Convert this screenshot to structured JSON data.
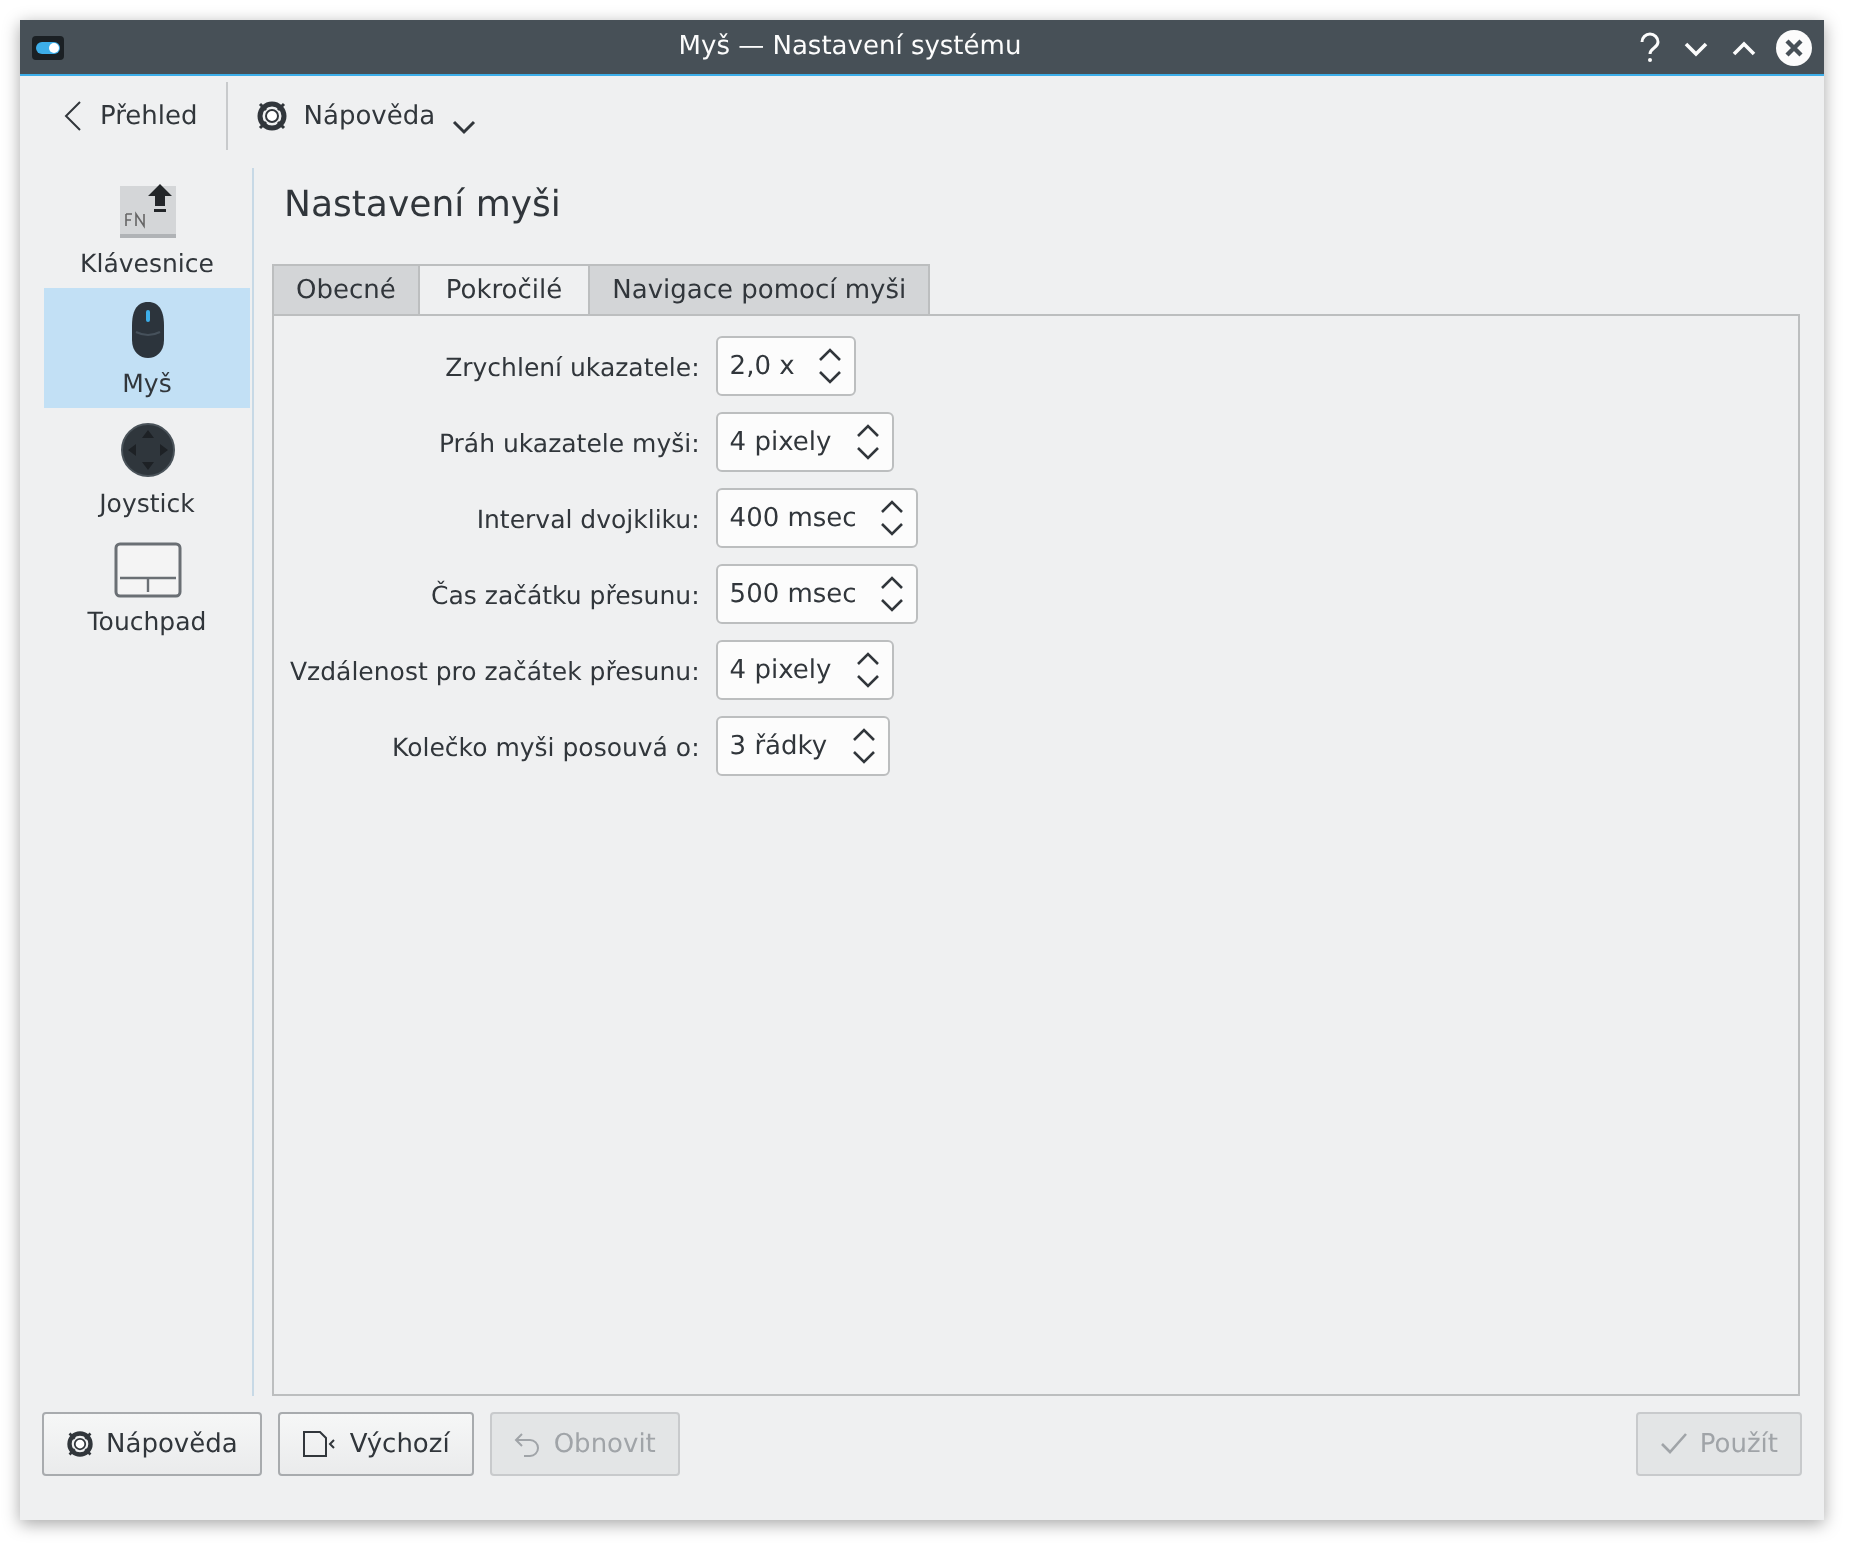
{
  "window": {
    "title": "Myš  — Nastavení systému"
  },
  "toolbar": {
    "back": "Přehled",
    "help": "Nápověda"
  },
  "sidebar": {
    "items": [
      {
        "label": "Klávesnice",
        "kind": "keyboard",
        "selected": false
      },
      {
        "label": "Myš",
        "kind": "mouse",
        "selected": true
      },
      {
        "label": "Joystick",
        "kind": "joystick",
        "selected": false
      },
      {
        "label": "Touchpad",
        "kind": "touchpad",
        "selected": false
      }
    ]
  },
  "page": {
    "title": "Nastavení myši"
  },
  "tabs": [
    {
      "label": "Obecné",
      "selected": false
    },
    {
      "label": "Pokročilé",
      "selected": true
    },
    {
      "label": "Navigace pomocí myši",
      "selected": false
    }
  ],
  "settings": [
    {
      "label": "Zrychlení ukazatele:",
      "value": "2,0 x"
    },
    {
      "label": "Práh ukazatele myši:",
      "value": "4 pixely"
    },
    {
      "label": "Interval dvojkliku:",
      "value": "400 msec"
    },
    {
      "label": "Čas začátku přesunu:",
      "value": "500 msec"
    },
    {
      "label": "Vzdálenost pro začátek přesunu:",
      "value": "4 pixely"
    },
    {
      "label": "Kolečko myši posouvá o:",
      "value": "3 řádky"
    }
  ],
  "buttons": [
    {
      "label": "Nápověda",
      "kind": "help",
      "disabled": false
    },
    {
      "label": "Výchozí",
      "kind": "defaults",
      "disabled": false
    },
    {
      "label": "Obnovit",
      "kind": "reset",
      "disabled": true
    },
    {
      "label": "Použít",
      "kind": "apply",
      "disabled": true
    }
  ]
}
